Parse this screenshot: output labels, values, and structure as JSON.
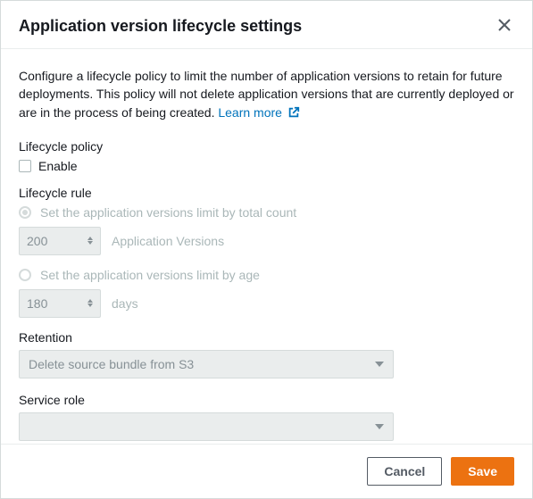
{
  "header": {
    "title": "Application version lifecycle settings"
  },
  "description": {
    "text": "Configure a lifecycle policy to limit the number of application versions to retain for future deployments. This policy will not delete application versions that are currently deployed or are in the process of being created. ",
    "learn_more": "Learn more"
  },
  "lifecycle_policy": {
    "label": "Lifecycle policy",
    "enable_label": "Enable"
  },
  "lifecycle_rule": {
    "label": "Lifecycle rule",
    "by_count_label": "Set the application versions limit by total count",
    "count_value": "200",
    "count_unit": "Application Versions",
    "by_age_label": "Set the application versions limit by age",
    "age_value": "180",
    "age_unit": "days"
  },
  "retention": {
    "label": "Retention",
    "selected": "Delete source bundle from S3"
  },
  "service_role": {
    "label": "Service role",
    "selected": ""
  },
  "footer": {
    "cancel": "Cancel",
    "save": "Save"
  }
}
